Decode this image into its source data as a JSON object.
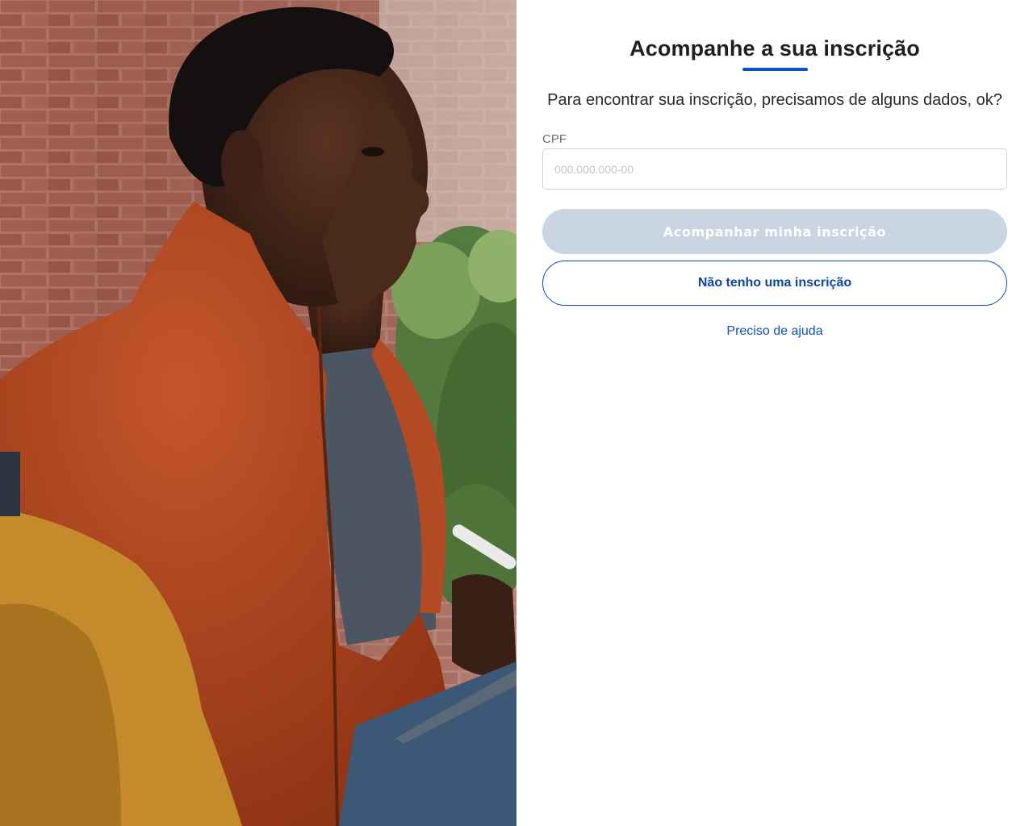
{
  "photo": {
    "description_icon": "student-photo"
  },
  "form": {
    "title": "Acompanhe a sua inscrição",
    "subtitle": "Para encontrar sua inscrição, precisamos de alguns dados, ok?",
    "cpf_label": "CPF",
    "cpf_value": "",
    "cpf_placeholder": "000.000.000-00",
    "primary_button_label": "Acompanhar minha inscrição",
    "secondary_button_label": "Não tenho uma inscrição",
    "help_link_label": "Preciso de ajuda"
  },
  "colors": {
    "accent": "#0b50c8",
    "primary_button_disabled": "#c9d5e1",
    "title_text": "#1f1f1f"
  }
}
